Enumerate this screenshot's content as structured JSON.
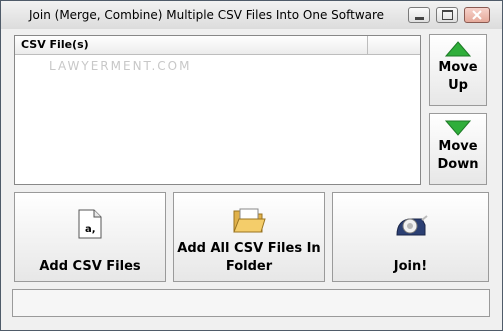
{
  "window": {
    "title": "Join (Merge, Combine) Multiple CSV Files Into One Software",
    "controls": {
      "minimize": "minimize",
      "maximize": "maximize",
      "close": "close"
    }
  },
  "file_list": {
    "column_header": "CSV File(s)",
    "watermark": "LAWYERMENT.COM",
    "items": []
  },
  "side_buttons": {
    "move_up": {
      "line1": "Move",
      "line2": "Up",
      "icon": "green-up-arrow-icon"
    },
    "move_down": {
      "line1": "Move",
      "line2": "Down",
      "icon": "green-down-arrow-icon"
    }
  },
  "actions": {
    "add_files": {
      "label": "Add CSV Files",
      "icon": "document-icon"
    },
    "add_folder": {
      "line1": "Add All CSV Files In",
      "line2": "Folder",
      "icon": "open-folder-icon"
    },
    "join": {
      "label": "Join!",
      "icon": "tape-dispenser-icon"
    }
  },
  "status": {
    "text": ""
  },
  "colors": {
    "arrow_green": "#2fae3a",
    "window_border": "#4f5b69",
    "close_red": "#e5a99a"
  }
}
